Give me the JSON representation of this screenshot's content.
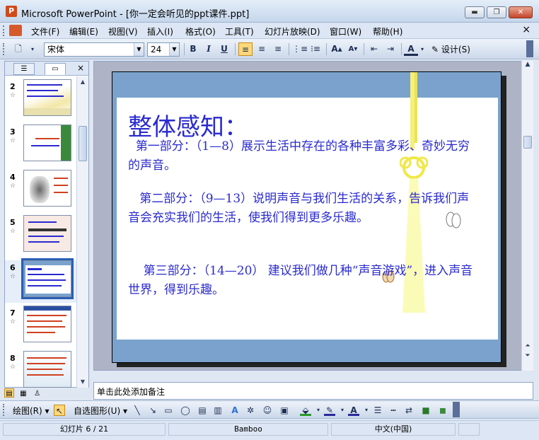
{
  "window": {
    "title": "Microsoft PowerPoint - [你一定会听见的ppt课件.ppt]",
    "minimize": "▬",
    "restore": "❐",
    "close": "✕"
  },
  "menu": {
    "items": [
      "文件(F)",
      "编辑(E)",
      "视图(V)",
      "插入(I)",
      "格式(O)",
      "工具(T)",
      "幻灯片放映(D)",
      "窗口(W)",
      "帮助(H)"
    ],
    "close": "×"
  },
  "toolbar": {
    "font_name": "宋体",
    "font_size": "24",
    "bold": "B",
    "italic": "I",
    "underline": "U",
    "design_label": "设计(S)"
  },
  "slides_pane": {
    "thumbnails": [
      {
        "number": "2",
        "star": "☆"
      },
      {
        "number": "3",
        "star": "☆"
      },
      {
        "number": "4",
        "star": "☆"
      },
      {
        "number": "5",
        "star": "☆"
      },
      {
        "number": "6",
        "star": "☆"
      },
      {
        "number": "7",
        "star": "☆"
      },
      {
        "number": "8",
        "star": "☆"
      }
    ],
    "selected": "6",
    "close": "×"
  },
  "slide": {
    "title": "整体感知：",
    "para1": "  第一部分：（1—8）展示生活中存在的各种丰富多彩、奇妙无穷的声音。",
    "para2": "   第二部分：（9—13）说明声音与我们生活的关系，告诉我们声音会充实我们的生活，使我们得到更多乐趣。",
    "para3": "    第三部分：（14—20） 建议我们做几种“声音游戏”，进入声音世界，得到乐趣。"
  },
  "notes": {
    "placeholder": "单击此处添加备注"
  },
  "drawing_toolbar": {
    "draw_label": "绘图(R)",
    "autoshape_label": "自选图形(U)"
  },
  "status": {
    "slide_info": "幻灯片 6 / 21",
    "design": "Bamboo",
    "language": "中文(中国)"
  }
}
